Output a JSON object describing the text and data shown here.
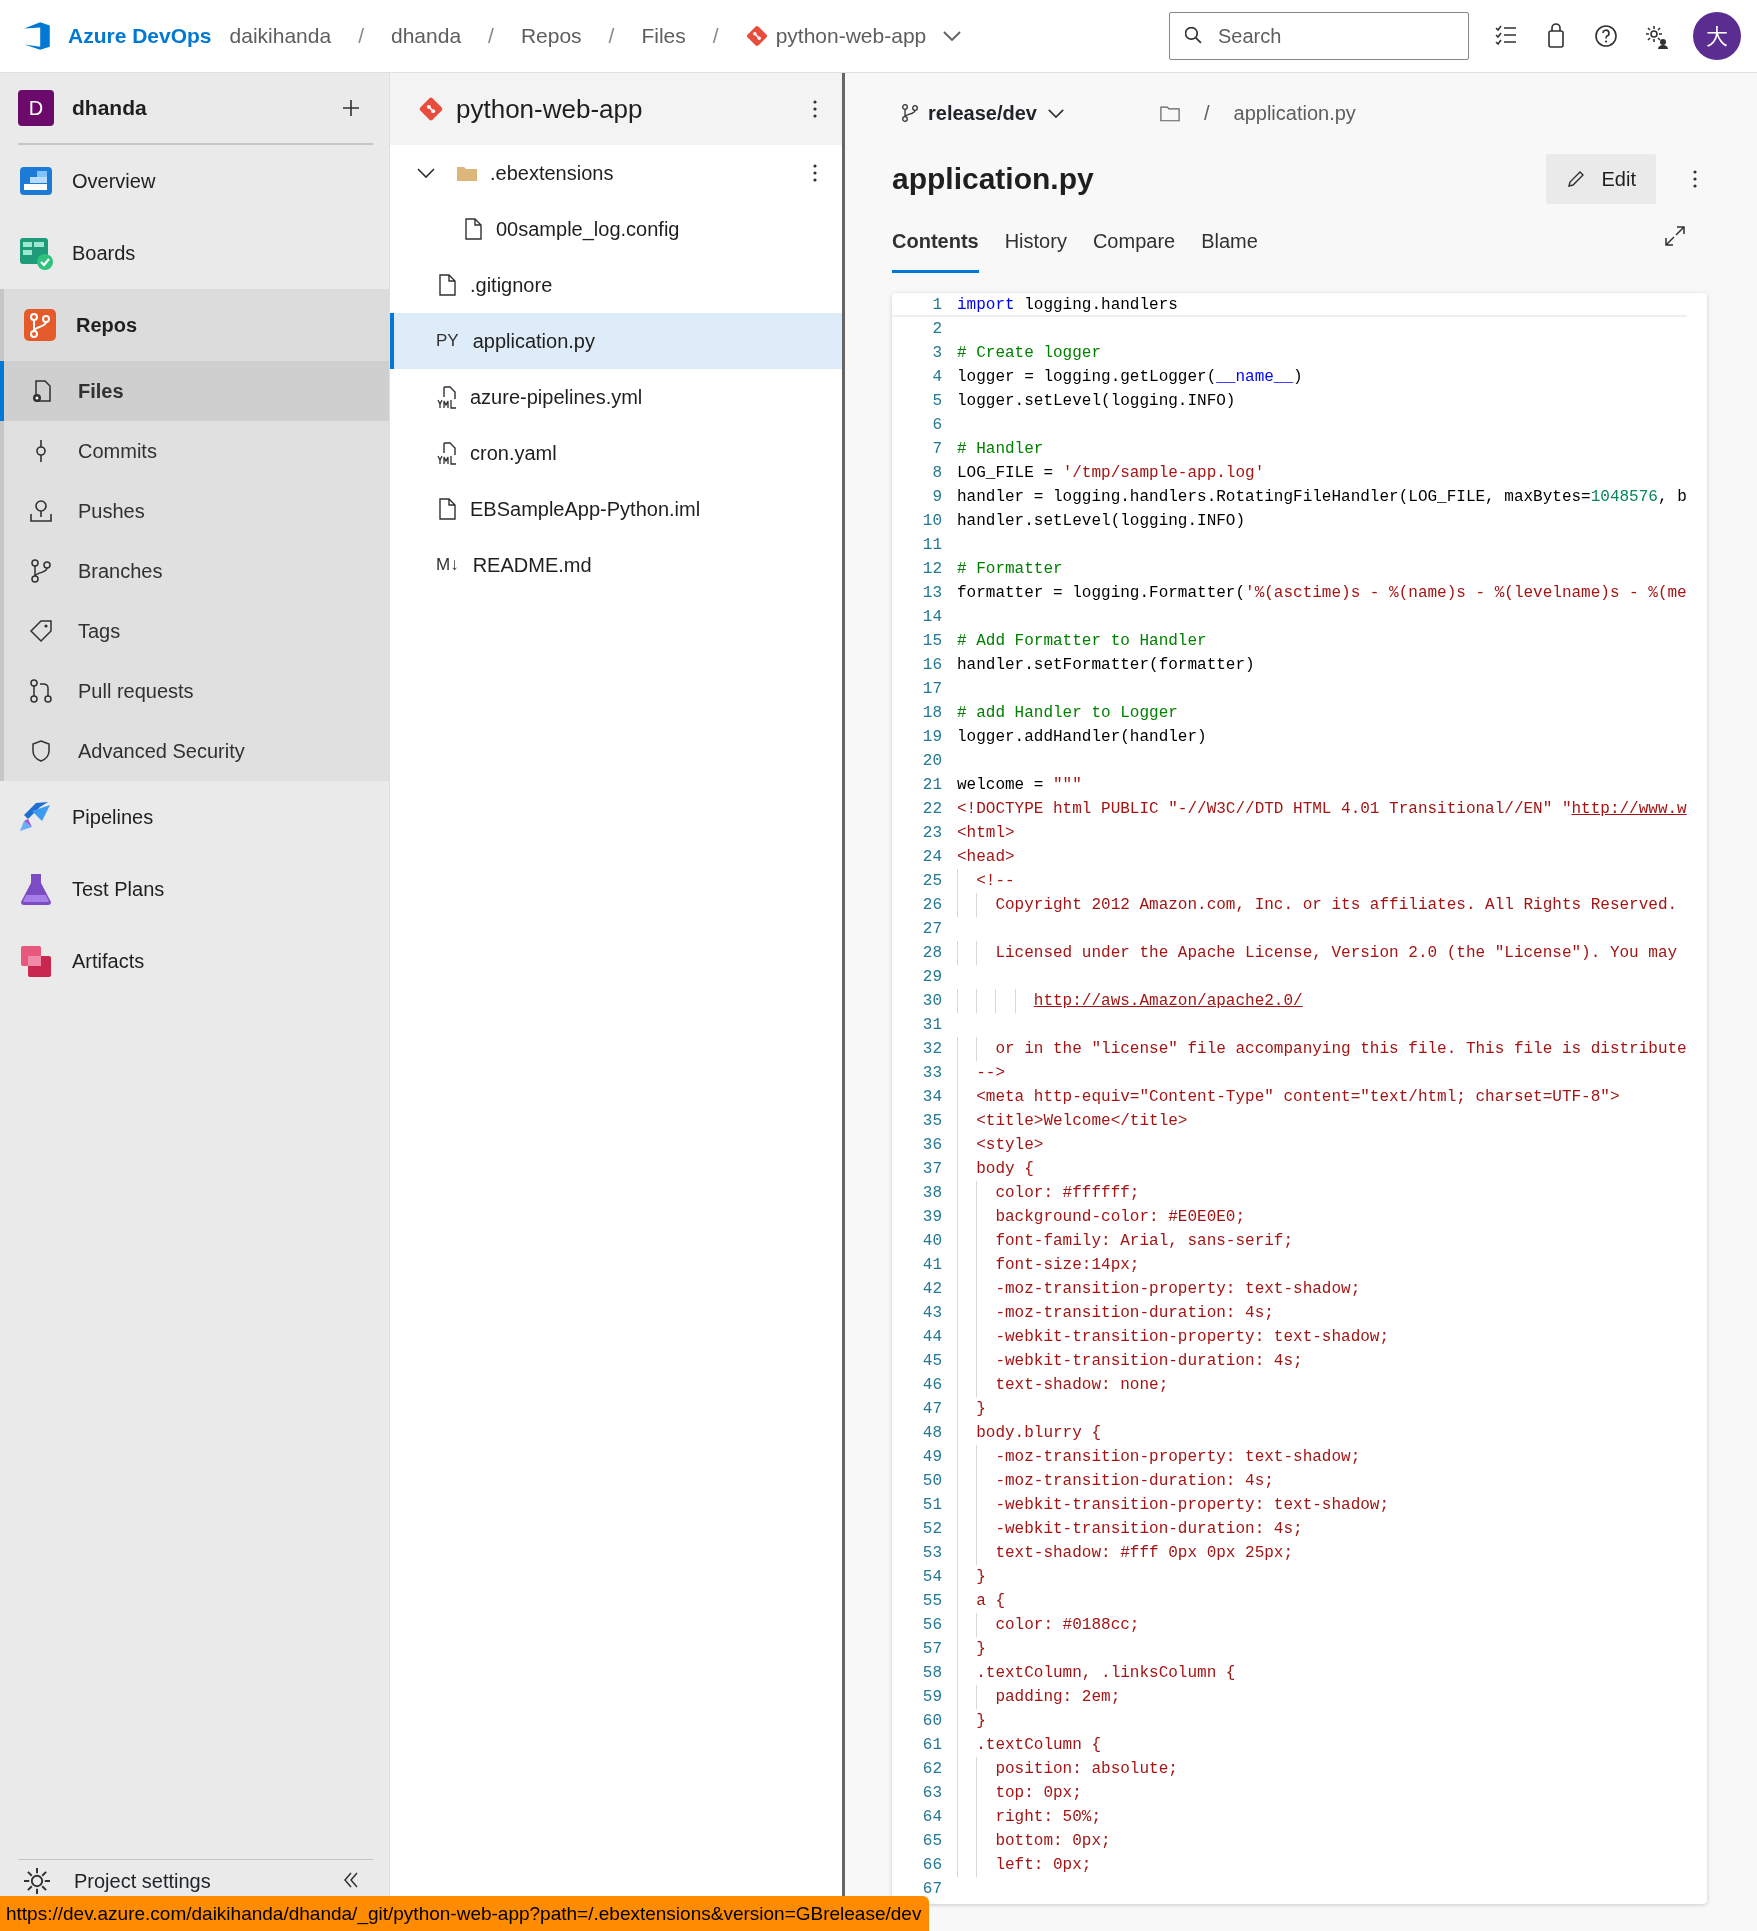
{
  "app_name": "Azure DevOps",
  "breadcrumbs": [
    {
      "kind": "link",
      "text": "daikihanda"
    },
    {
      "kind": "separator",
      "text": "/"
    },
    {
      "kind": "link",
      "text": "dhanda"
    },
    {
      "kind": "separator",
      "text": "/"
    },
    {
      "kind": "link",
      "text": "Repos"
    },
    {
      "kind": "separator",
      "text": "/"
    },
    {
      "kind": "link",
      "text": "Files"
    },
    {
      "kind": "separator",
      "text": "/"
    },
    {
      "kind": "repo",
      "text": "python-web-app"
    }
  ],
  "search": {
    "placeholder": "Search"
  },
  "user": {
    "initial": "大"
  },
  "project": {
    "initial": "D",
    "name": "dhanda"
  },
  "nav": [
    {
      "label": "Overview",
      "selected": false
    },
    {
      "label": "Boards",
      "selected": false
    },
    {
      "label": "Repos",
      "selected": false,
      "expanded": true,
      "children": [
        {
          "label": "Files",
          "selected": true
        },
        {
          "label": "Commits",
          "selected": false
        },
        {
          "label": "Pushes",
          "selected": false
        },
        {
          "label": "Branches",
          "selected": false
        },
        {
          "label": "Tags",
          "selected": false
        },
        {
          "label": "Pull requests",
          "selected": false
        },
        {
          "label": "Advanced Security",
          "selected": false
        }
      ]
    },
    {
      "label": "Pipelines",
      "selected": false
    },
    {
      "label": "Test Plans",
      "selected": false
    },
    {
      "label": "Artifacts",
      "selected": false
    }
  ],
  "footer": {
    "label": "Project settings"
  },
  "repo": {
    "name": "python-web-app"
  },
  "tree": [
    {
      "kind": "folder",
      "name": ".ebextensions",
      "expanded": true,
      "selected": false,
      "children": [
        {
          "kind": "file",
          "name": "00sample_log.config",
          "selected": false
        }
      ]
    },
    {
      "kind": "file",
      "name": ".gitignore",
      "selected": false
    },
    {
      "kind": "python",
      "icon_text": "PY",
      "name": "application.py",
      "selected": true
    },
    {
      "kind": "yaml",
      "name": "azure-pipelines.yml",
      "selected": false
    },
    {
      "kind": "yaml",
      "name": "cron.yaml",
      "selected": false
    },
    {
      "kind": "file",
      "name": "EBSampleApp-Python.iml",
      "selected": false
    },
    {
      "kind": "markdown",
      "icon_text": "M↓",
      "name": "README.md",
      "selected": false
    }
  ],
  "file": {
    "branch": "release/dev",
    "path_separator": "/",
    "path_file": "application.py",
    "title": "application.py",
    "edit_label": "Edit",
    "tabs": [
      {
        "label": "Contents",
        "selected": true
      },
      {
        "label": "History",
        "selected": false
      },
      {
        "label": "Compare",
        "selected": false
      },
      {
        "label": "Blame",
        "selected": false
      }
    ]
  },
  "code": [
    {
      "number": "1",
      "tokens": [
        {
          "kind": "keyword",
          "text": "import"
        },
        {
          "kind": "plain",
          "text": " logging.handlers"
        }
      ]
    },
    {
      "number": "2"
    },
    {
      "number": "3",
      "tokens": [
        {
          "kind": "comment",
          "text": "# Create logger"
        }
      ]
    },
    {
      "number": "4",
      "tokens": [
        {
          "kind": "plain",
          "text": "logger = logging.getLogger("
        },
        {
          "kind": "builtin",
          "text": "__name__"
        },
        {
          "kind": "plain",
          "text": ")"
        }
      ]
    },
    {
      "number": "5",
      "tokens": [
        {
          "kind": "plain",
          "text": "logger.setLevel(logging.INFO)"
        }
      ]
    },
    {
      "number": "6"
    },
    {
      "number": "7",
      "tokens": [
        {
          "kind": "comment",
          "text": "# Handler"
        }
      ]
    },
    {
      "number": "8",
      "tokens": [
        {
          "kind": "plain",
          "text": "LOG_FILE = "
        },
        {
          "kind": "string",
          "text": "'/tmp/sample-app.log'"
        }
      ]
    },
    {
      "number": "9",
      "tokens": [
        {
          "kind": "plain",
          "text": "handler = logging.handlers.RotatingFileHandler(LOG_FILE, maxBytes="
        },
        {
          "kind": "number",
          "text": "1048576"
        },
        {
          "kind": "plain",
          "text": ", b"
        }
      ]
    },
    {
      "number": "10",
      "tokens": [
        {
          "kind": "plain",
          "text": "handler.setLevel(logging.INFO)"
        }
      ]
    },
    {
      "number": "11"
    },
    {
      "number": "12",
      "tokens": [
        {
          "kind": "comment",
          "text": "# Formatter"
        }
      ]
    },
    {
      "number": "13",
      "tokens": [
        {
          "kind": "plain",
          "text": "formatter = logging.Formatter("
        },
        {
          "kind": "string",
          "text": "'%(asctime)s - %(name)s - %(levelname)s - %(me"
        }
      ]
    },
    {
      "number": "14"
    },
    {
      "number": "15",
      "tokens": [
        {
          "kind": "comment",
          "text": "# Add Formatter to Handler"
        }
      ]
    },
    {
      "number": "16",
      "tokens": [
        {
          "kind": "plain",
          "text": "handler.setFormatter(formatter)"
        }
      ]
    },
    {
      "number": "17"
    },
    {
      "number": "18",
      "tokens": [
        {
          "kind": "comment",
          "text": "# add Handler to Logger"
        }
      ]
    },
    {
      "number": "19",
      "tokens": [
        {
          "kind": "plain",
          "text": "logger.addHandler(handler)"
        }
      ]
    },
    {
      "number": "20"
    },
    {
      "number": "21",
      "tokens": [
        {
          "kind": "plain",
          "text": "welcome = "
        },
        {
          "kind": "string",
          "text": "\"\"\""
        }
      ]
    },
    {
      "number": "22",
      "tokens": [
        {
          "kind": "string",
          "text": "<!DOCTYPE html PUBLIC \"-//W3C//DTD HTML 4.01 Transitional//EN\" \""
        },
        {
          "kind": "link",
          "text": "http://www.w"
        }
      ]
    },
    {
      "number": "23",
      "tokens": [
        {
          "kind": "string",
          "text": "<html>"
        }
      ]
    },
    {
      "number": "24",
      "tokens": [
        {
          "kind": "string",
          "text": "<head>"
        }
      ]
    },
    {
      "number": "25",
      "tokens": [
        {
          "kind": "string",
          "text": "  <!--"
        }
      ]
    },
    {
      "number": "26",
      "tokens": [
        {
          "kind": "string",
          "text": "    Copyright 2012 Amazon.com, Inc. or its affiliates. All Rights Reserved."
        }
      ]
    },
    {
      "number": "27"
    },
    {
      "number": "28",
      "tokens": [
        {
          "kind": "string",
          "text": "    Licensed under the Apache License, Version 2.0 (the \"License\"). You may"
        }
      ]
    },
    {
      "number": "29"
    },
    {
      "number": "30",
      "tokens": [
        {
          "kind": "link",
          "text": "        http://aws.Amazon/apache2.0/"
        }
      ]
    },
    {
      "number": "31"
    },
    {
      "number": "32",
      "tokens": [
        {
          "kind": "string",
          "text": "    or in the \"license\" file accompanying this file. This file is distribute"
        }
      ]
    },
    {
      "number": "33",
      "tokens": [
        {
          "kind": "string",
          "text": "  -->"
        }
      ]
    },
    {
      "number": "34",
      "tokens": [
        {
          "kind": "string",
          "text": "  <meta http-equiv=\"Content-Type\" content=\"text/html; charset=UTF-8\">"
        }
      ]
    },
    {
      "number": "35",
      "tokens": [
        {
          "kind": "string",
          "text": "  <title>Welcome</title>"
        }
      ]
    },
    {
      "number": "36",
      "tokens": [
        {
          "kind": "string",
          "text": "  <style>"
        }
      ]
    },
    {
      "number": "37",
      "tokens": [
        {
          "kind": "string",
          "text": "  body {"
        }
      ]
    },
    {
      "number": "38",
      "tokens": [
        {
          "kind": "string",
          "text": "    color: #ffffff;"
        }
      ]
    },
    {
      "number": "39",
      "tokens": [
        {
          "kind": "string",
          "text": "    background-color: #E0E0E0;"
        }
      ]
    },
    {
      "number": "40",
      "tokens": [
        {
          "kind": "string",
          "text": "    font-family: Arial, sans-serif;"
        }
      ]
    },
    {
      "number": "41",
      "tokens": [
        {
          "kind": "string",
          "text": "    font-size:14px;"
        }
      ]
    },
    {
      "number": "42",
      "tokens": [
        {
          "kind": "string",
          "text": "    -moz-transition-property: text-shadow;"
        }
      ]
    },
    {
      "number": "43",
      "tokens": [
        {
          "kind": "string",
          "text": "    -moz-transition-duration: 4s;"
        }
      ]
    },
    {
      "number": "44",
      "tokens": [
        {
          "kind": "string",
          "text": "    -webkit-transition-property: text-shadow;"
        }
      ]
    },
    {
      "number": "45",
      "tokens": [
        {
          "kind": "string",
          "text": "    -webkit-transition-duration: 4s;"
        }
      ]
    },
    {
      "number": "46",
      "tokens": [
        {
          "kind": "string",
          "text": "    text-shadow: none;"
        }
      ]
    },
    {
      "number": "47",
      "tokens": [
        {
          "kind": "string",
          "text": "  }"
        }
      ]
    },
    {
      "number": "48",
      "tokens": [
        {
          "kind": "string",
          "text": "  body.blurry {"
        }
      ]
    },
    {
      "number": "49",
      "tokens": [
        {
          "kind": "string",
          "text": "    -moz-transition-property: text-shadow;"
        }
      ]
    },
    {
      "number": "50",
      "tokens": [
        {
          "kind": "string",
          "text": "    -moz-transition-duration: 4s;"
        }
      ]
    },
    {
      "number": "51",
      "tokens": [
        {
          "kind": "string",
          "text": "    -webkit-transition-property: text-shadow;"
        }
      ]
    },
    {
      "number": "52",
      "tokens": [
        {
          "kind": "string",
          "text": "    -webkit-transition-duration: 4s;"
        }
      ]
    },
    {
      "number": "53",
      "tokens": [
        {
          "kind": "string",
          "text": "    text-shadow: #fff 0px 0px 25px;"
        }
      ]
    },
    {
      "number": "54",
      "tokens": [
        {
          "kind": "string",
          "text": "  }"
        }
      ]
    },
    {
      "number": "55",
      "tokens": [
        {
          "kind": "string",
          "text": "  a {"
        }
      ]
    },
    {
      "number": "56",
      "tokens": [
        {
          "kind": "string",
          "text": "    color: #0188cc;"
        }
      ]
    },
    {
      "number": "57",
      "tokens": [
        {
          "kind": "string",
          "text": "  }"
        }
      ]
    },
    {
      "number": "58",
      "tokens": [
        {
          "kind": "string",
          "text": "  .textColumn, .linksColumn {"
        }
      ]
    },
    {
      "number": "59",
      "tokens": [
        {
          "kind": "string",
          "text": "    padding: 2em;"
        }
      ]
    },
    {
      "number": "60",
      "tokens": [
        {
          "kind": "string",
          "text": "  }"
        }
      ]
    },
    {
      "number": "61",
      "tokens": [
        {
          "kind": "string",
          "text": "  .textColumn {"
        }
      ]
    },
    {
      "number": "62",
      "tokens": [
        {
          "kind": "string",
          "text": "    position: absolute;"
        }
      ]
    },
    {
      "number": "63",
      "tokens": [
        {
          "kind": "string",
          "text": "    top: 0px;"
        }
      ]
    },
    {
      "number": "64",
      "tokens": [
        {
          "kind": "string",
          "text": "    right: 50%;"
        }
      ]
    },
    {
      "number": "65",
      "tokens": [
        {
          "kind": "string",
          "text": "    bottom: 0px;"
        }
      ]
    },
    {
      "number": "66",
      "tokens": [
        {
          "kind": "string",
          "text": "    left: 0px;"
        }
      ]
    },
    {
      "number": "67"
    }
  ],
  "status_url": "https://dev.azure.com/daikihanda/dhanda/_git/python-web-app?path=/.ebextensions&version=GBrelease/dev"
}
